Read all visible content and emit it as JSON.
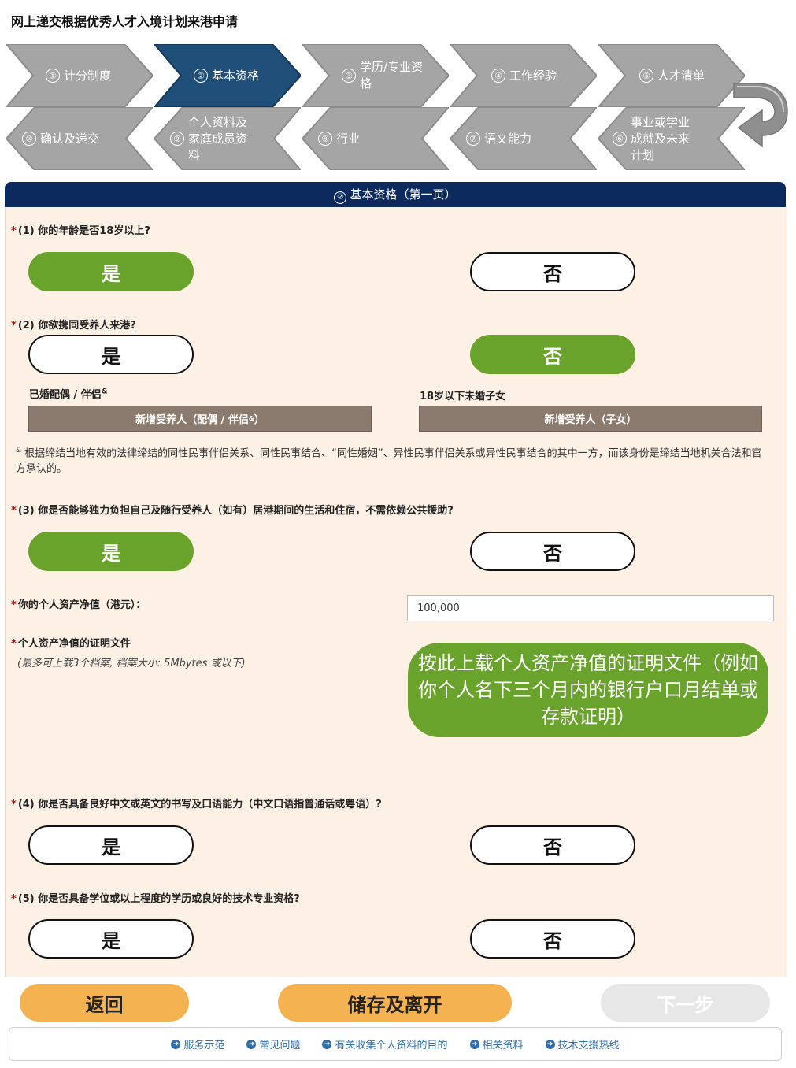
{
  "page_title": "网上递交根据优秀人才入境计划来港申请",
  "steps": [
    {
      "num": "①",
      "label": "计分制度",
      "active": false
    },
    {
      "num": "②",
      "label": "基本资格",
      "active": true
    },
    {
      "num": "③",
      "label": "学历/专业资格",
      "active": false
    },
    {
      "num": "④",
      "label": "工作经验",
      "active": false
    },
    {
      "num": "⑤",
      "label": "人才清单",
      "active": false
    },
    {
      "num": "⑥",
      "label": "事业或学业成就及未来计划",
      "active": false
    },
    {
      "num": "⑦",
      "label": "语文能力",
      "active": false
    },
    {
      "num": "⑧",
      "label": "行业",
      "active": false
    },
    {
      "num": "⑨",
      "label": "个人资料及家庭成员资料",
      "active": false
    },
    {
      "num": "⑩",
      "label": "确认及递交",
      "active": false
    }
  ],
  "section": {
    "num": "②",
    "title": "基本资格（第一页）"
  },
  "questions": {
    "q1": {
      "text": "(1) 你的年龄是否18岁以上?",
      "selected": "yes"
    },
    "q2": {
      "text": "(2) 你欲携同受养人来港?",
      "selected": "no"
    },
    "q3": {
      "text": "(3) 你是否能够独力负担自己及随行受养人（如有）居港期间的生活和住宿，不需依赖公共援助?",
      "selected": "yes"
    },
    "q4": {
      "text": "(4) 你是否具备良好中文或英文的书写及口语能力（中文口语指普通话或粤语）?",
      "selected": "none"
    },
    "q5": {
      "text": "(5) 你是否具备学位或以上程度的学历或良好的技术专业资格?",
      "selected": "none"
    }
  },
  "yes_label": "是",
  "no_label": "否",
  "spouse_label": "已婚配偶 / 伴侣",
  "spouse_sup": "&",
  "children_label": "18岁以下未婚子女",
  "add_spouse_btn": "新增受养人（配偶 / 伴侣",
  "add_spouse_btn_end": "）",
  "add_child_btn": "新增受养人（子女）",
  "footnote_mark": "&",
  "footnote": "根据缔结当地有效的法律缔结的同性民事伴侣关系、同性民事结合、“同性婚姻”、异性民事伴侣关系或异性民事结合的其中一方，而该身份是缔结当地机关合法和官方承认的。",
  "asset_label": "你的个人资产净值（港元）：",
  "asset_value": "100,000",
  "proof_label": "个人资产净值的证明文件",
  "proof_hint": "(最多可上载3个档案, 档案大小: 5Mbytes 或以下)",
  "upload_button": "按此上载个人资产净值的证明文件（例如你个人名下三个月内的银行户口月结单或存款证明）",
  "bottom": {
    "back": "返回",
    "save": "储存及离开",
    "next": "下一步"
  },
  "footer_links": [
    "服务示范",
    "常见问题",
    "有关收集个人资料的目的",
    "相关资料",
    "技术支援热线"
  ],
  "colors": {
    "active_step": "#1f4e79",
    "step_gray": "#9e9e9e",
    "selected": "#6aa32c",
    "header_navy": "#0d2a5e",
    "action_orange": "#f4b350",
    "link_blue": "#2f6fb0"
  }
}
